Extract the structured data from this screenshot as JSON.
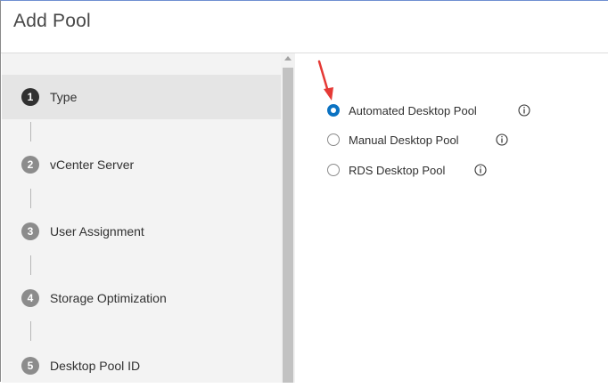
{
  "header": {
    "title": "Add Pool"
  },
  "sidebar": {
    "steps": [
      {
        "number": "1",
        "label": "Type",
        "active": true
      },
      {
        "number": "2",
        "label": "vCenter Server",
        "active": false
      },
      {
        "number": "3",
        "label": "User Assignment",
        "active": false
      },
      {
        "number": "4",
        "label": "Storage Optimization",
        "active": false
      },
      {
        "number": "5",
        "label": "Desktop Pool ID",
        "active": false
      }
    ]
  },
  "main": {
    "options": [
      {
        "label": "Automated Desktop Pool",
        "selected": true,
        "icon": "info-icon"
      },
      {
        "label": "Manual Desktop Pool",
        "selected": false,
        "icon": "info-icon"
      },
      {
        "label": "RDS Desktop Pool",
        "selected": false,
        "icon": "info-icon"
      }
    ]
  },
  "colors": {
    "accent": "#0b72c2",
    "annotation_arrow": "#e53935",
    "active_step_badge": "#313131",
    "inactive_step_badge": "#8c8c8c"
  }
}
